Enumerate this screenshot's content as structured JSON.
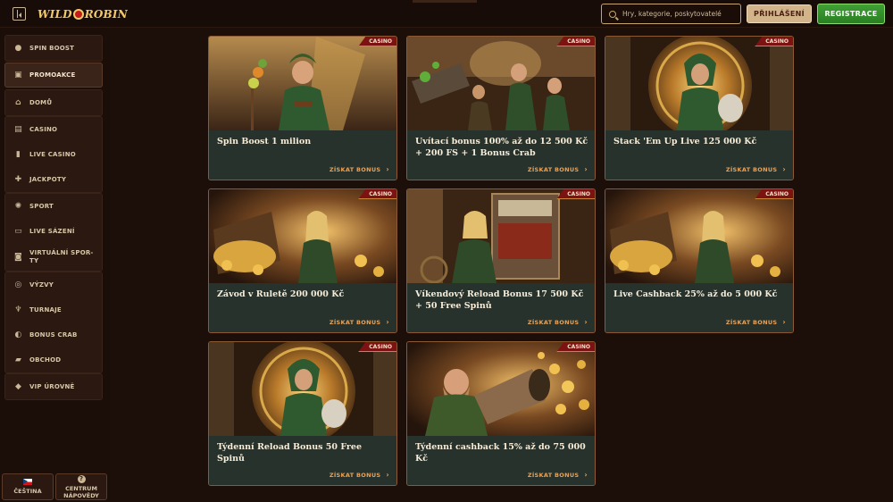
{
  "header": {
    "logo_part1": "WILD",
    "logo_part2": "ROBIN",
    "search_placeholder": "Hry, kategorie, poskytovatelé",
    "login_label": "PŘIHLÁŠENÍ",
    "register_label": "REGISTRACE"
  },
  "sidebar": {
    "groups": [
      {
        "items": [
          {
            "label": "SPIN BOOST",
            "icon": "coin-bag-icon"
          }
        ]
      },
      {
        "items": [
          {
            "label": "PROMOAKCE",
            "icon": "gift-icon",
            "active": true
          }
        ]
      },
      {
        "items": [
          {
            "label": "DOMŮ",
            "icon": "home-icon"
          }
        ]
      },
      {
        "items": [
          {
            "label": "CASINO",
            "icon": "slot-icon"
          },
          {
            "label": "LIVE CASINO",
            "icon": "cards-icon"
          },
          {
            "label": "JACKPOTY",
            "icon": "clover-icon"
          }
        ]
      },
      {
        "items": [
          {
            "label": "SPORT",
            "icon": "ball-icon"
          },
          {
            "label": "LIVE SÁZENÍ",
            "icon": "live-icon"
          },
          {
            "label": "VIRTUÁLNÍ SPORTY",
            "label_line1": "VIRTUÁLNÍ SPOR-",
            "label_line2": "TY",
            "icon": "virtual-icon"
          }
        ]
      },
      {
        "items": [
          {
            "label": "VÝZVY",
            "icon": "target-icon"
          },
          {
            "label": "TURNAJE",
            "icon": "trophy-icon"
          },
          {
            "label": "BONUS CRAB",
            "icon": "crab-icon"
          },
          {
            "label": "OBCHOD",
            "icon": "shop-icon"
          }
        ]
      },
      {
        "items": [
          {
            "label": "VIP ÚROVNĚ",
            "icon": "diamond-icon"
          }
        ]
      }
    ],
    "language_label": "ČEŠTINA",
    "help_label_line1": "CENTRUM",
    "help_label_line2": "NÁPOVĚDY"
  },
  "cards": [
    {
      "title": "Spin Boost 1 milion",
      "badge": "CASINO",
      "cta": "ZÍSKAT BONUS"
    },
    {
      "title": "Uvítací bonus 100% až do 12 500 Kč + 200 FS + 1 Bonus Crab",
      "badge": "CASINO",
      "cta": "ZÍSKAT BONUS"
    },
    {
      "title": "Stack 'Em Up Live 125 000 Kč",
      "badge": "CASINO",
      "cta": "ZÍSKAT BONUS"
    },
    {
      "title": "Závod v Ruletě 200 000 Kč",
      "badge": "CASINO",
      "cta": "ZÍSKAT BONUS"
    },
    {
      "title": "Víkendový Reload Bonus 17 500 Kč + 50 Free Spinů",
      "badge": "CASINO",
      "cta": "ZÍSKAT BONUS"
    },
    {
      "title": "Live Cashback 25% až do 5 000 Kč",
      "badge": "CASINO",
      "cta": "ZÍSKAT BONUS"
    },
    {
      "title": "Týdenní Reload Bonus 50 Free Spinů",
      "badge": "CASINO",
      "cta": "ZÍSKAT BONUS"
    },
    {
      "title": "Týdenní cashback 15% až do 75 000 Kč",
      "badge": "CASINO",
      "cta": "ZÍSKAT BONUS"
    }
  ],
  "colors": {
    "background": "#1c0f0a",
    "card_body": "#27322c",
    "card_border": "#8b5a34",
    "cta": "#e8a35a",
    "badge": "#7d1212",
    "register_green": "#3fa034",
    "login_tan": "#d2b48a"
  }
}
